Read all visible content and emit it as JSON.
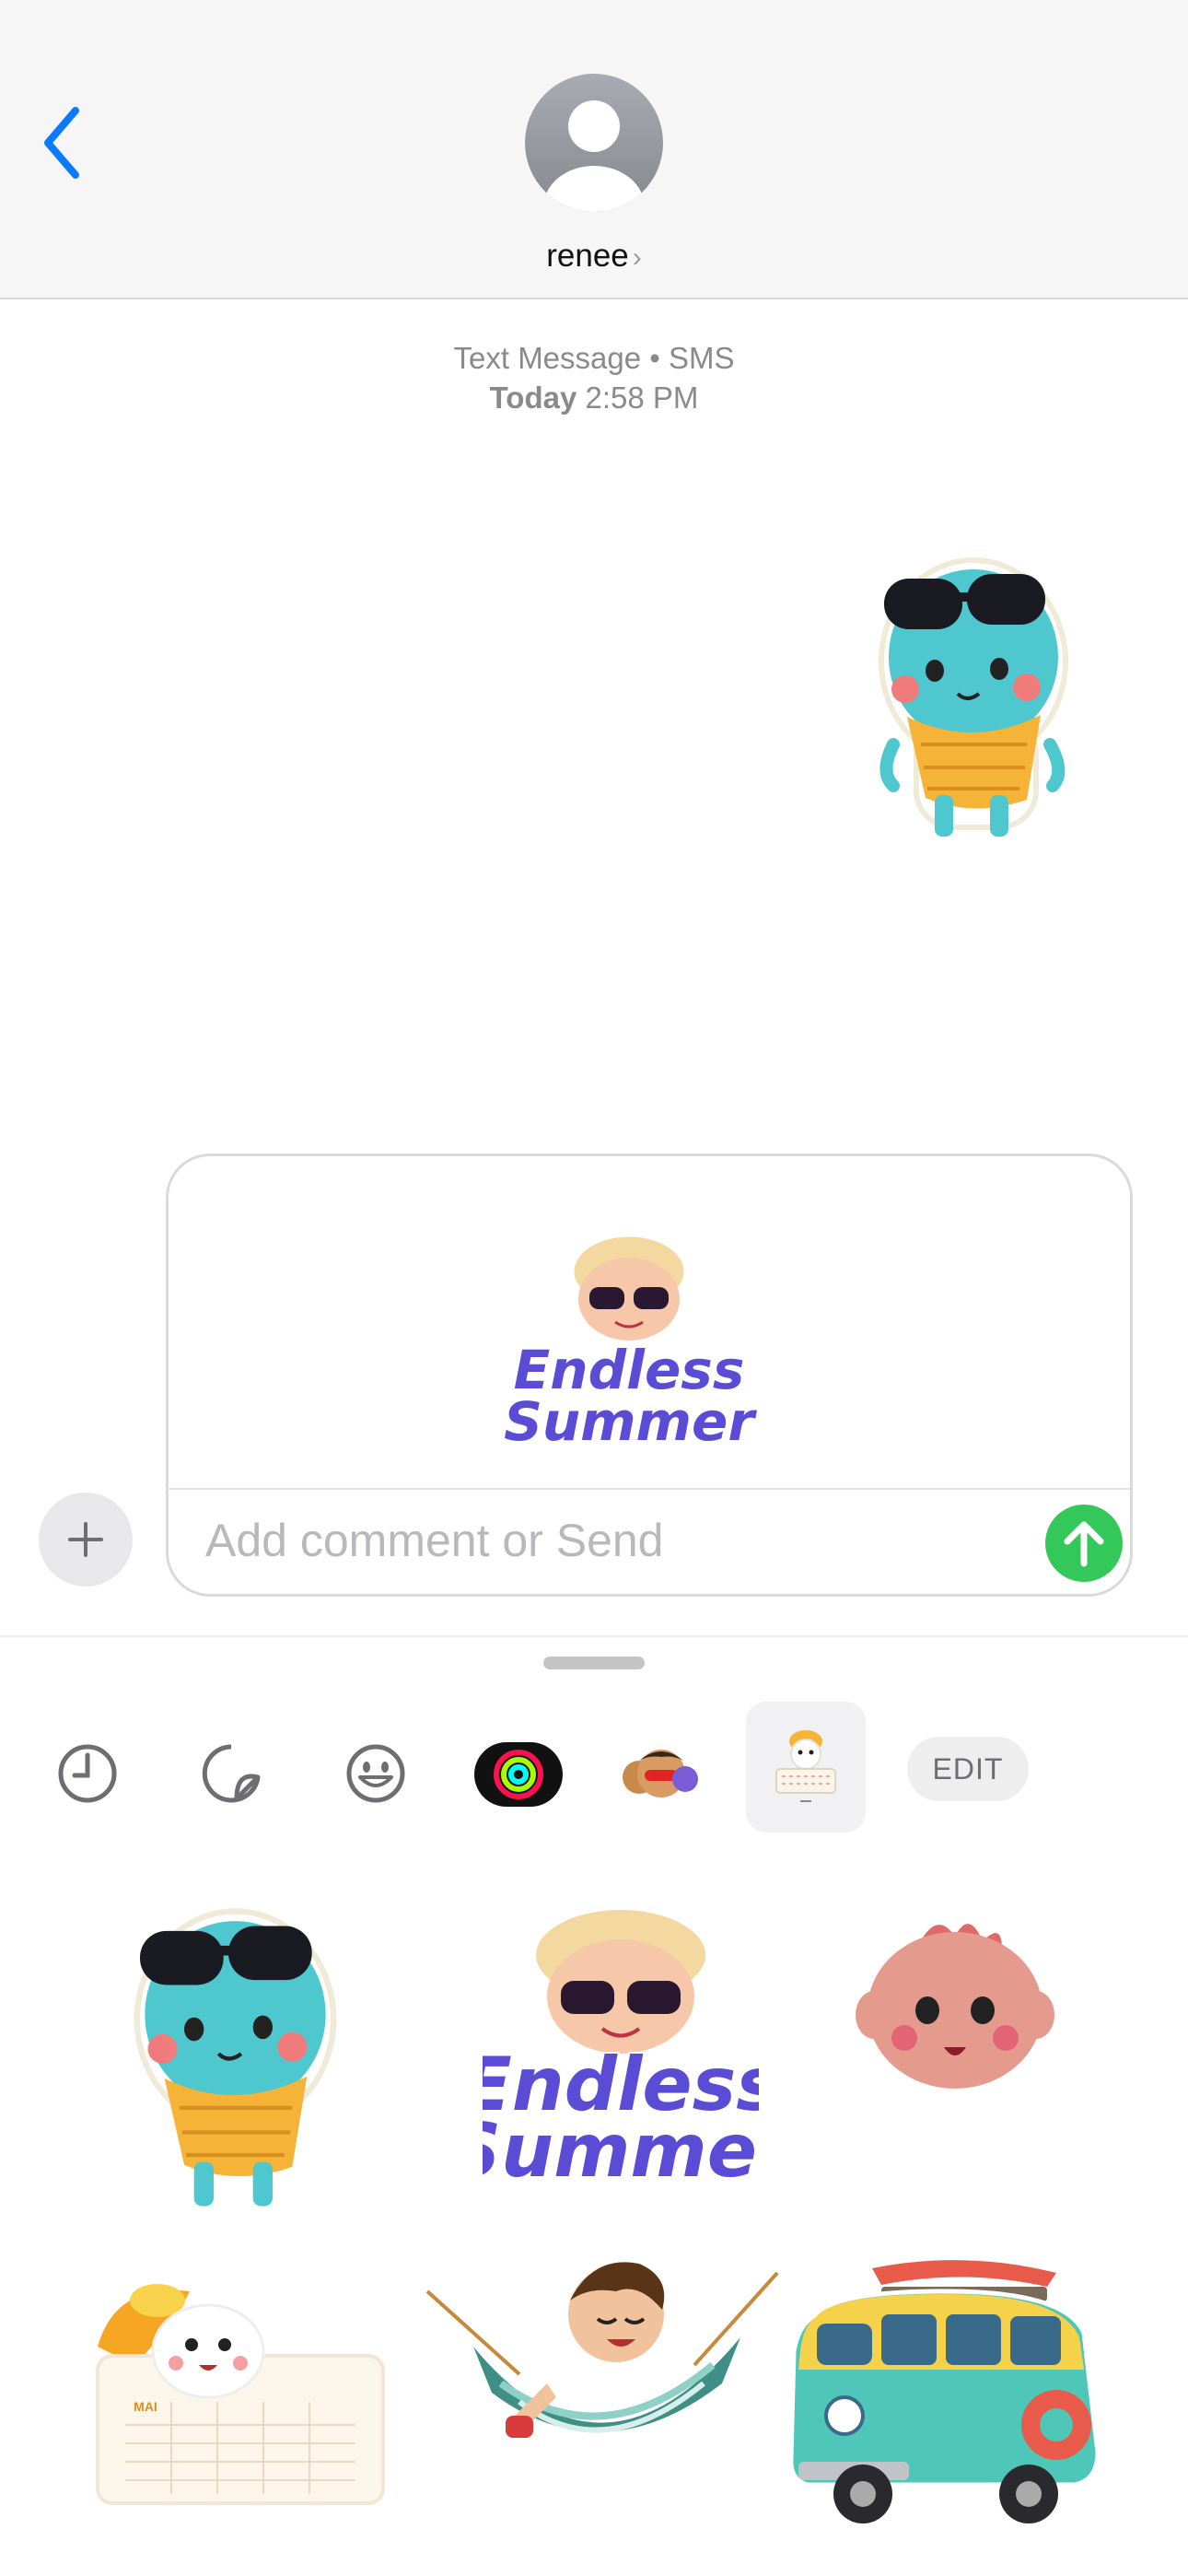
{
  "header": {
    "contact_name": "renee",
    "contact_chevron": "›",
    "back_icon": "chevron-left-icon",
    "avatar_icon": "person-avatar-icon"
  },
  "transcript": {
    "service": "Text Message • SMS",
    "time_day": "Today",
    "time_clock": "2:58 PM"
  },
  "compose": {
    "placeholder": "Add comment or Send",
    "preview_sticker_text": "Endless Summer",
    "plus_icon": "plus-icon",
    "send_icon": "arrow-up-icon"
  },
  "drawer": {
    "tabs": [
      {
        "id": "recents",
        "icon": "clock-icon"
      },
      {
        "id": "stickers",
        "icon": "peel-sticker-icon"
      },
      {
        "id": "emoji",
        "icon": "smiley-icon"
      },
      {
        "id": "activity",
        "icon": "activity-rings-icon"
      },
      {
        "id": "memoji",
        "icon": "memoji-icon"
      },
      {
        "id": "sticker-app",
        "icon": "sticker-pack-icon"
      }
    ],
    "edit_label": "EDIT",
    "stickers": [
      {
        "name": "cool-blue-character-sticker"
      },
      {
        "name": "endless-summer-sticker",
        "text": "Endless Summer"
      },
      {
        "name": "pink-baby-face-sticker"
      },
      {
        "name": "summer-calendar-sticker",
        "text": "MAI"
      },
      {
        "name": "hammock-boy-sticker"
      },
      {
        "name": "surf-van-sticker"
      }
    ]
  },
  "colors": {
    "accent_blue": "#0a7aff",
    "send_green": "#34c759",
    "header_bg": "#f6f6f6",
    "meta_gray": "#8a8a8e"
  }
}
